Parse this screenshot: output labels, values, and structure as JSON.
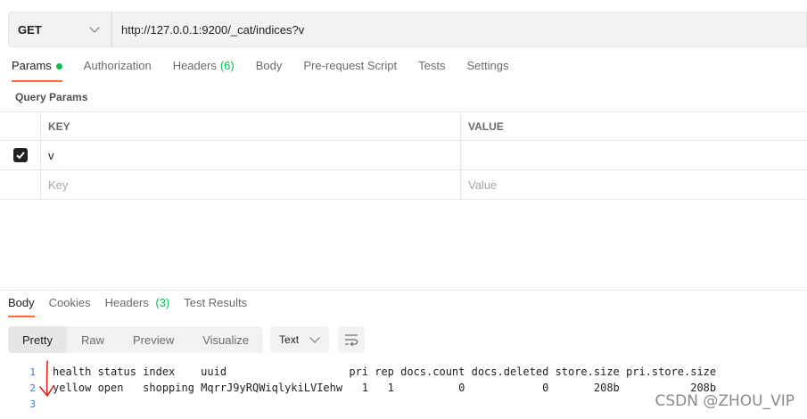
{
  "request": {
    "method": "GET",
    "url": "http://127.0.0.1:9200/_cat/indices?v"
  },
  "request_tabs": [
    {
      "label": "Params",
      "active": true
    },
    {
      "label": "Authorization"
    },
    {
      "label": "Headers",
      "count": "(6)"
    },
    {
      "label": "Body"
    },
    {
      "label": "Pre-request Script"
    },
    {
      "label": "Tests"
    },
    {
      "label": "Settings"
    }
  ],
  "query_params": {
    "title": "Query Params",
    "header": {
      "key": "KEY",
      "value": "VALUE"
    },
    "rows": [
      {
        "key": "v",
        "value": "",
        "checked": true
      }
    ],
    "placeholder": {
      "key": "Key",
      "value": "Value"
    }
  },
  "response_tabs": [
    {
      "label": "Body",
      "active": true
    },
    {
      "label": "Cookies"
    },
    {
      "label": "Headers",
      "count": "(3)"
    },
    {
      "label": "Test Results"
    }
  ],
  "view_modes": [
    "Pretty",
    "Raw",
    "Preview",
    "Visualize"
  ],
  "active_view": "Pretty",
  "format": "Text",
  "response_lines": [
    {
      "n": "1",
      "text": "health status index    uuid                   pri rep docs.count docs.deleted store.size pri.store.size"
    },
    {
      "n": "2",
      "text": "yellow open   shopping MqrrJ9yRQWiqlykiLVIehw   1   1          0            0       208b           208b"
    },
    {
      "n": "3",
      "text": ""
    }
  ],
  "watermark": "CSDN @ZHOU_VIP",
  "colors": {
    "accent": "#ff6c37",
    "green": "#0cbb52",
    "annotation": "#d9261c"
  },
  "icons": {
    "method_dropdown": "chevron-down-icon",
    "checkbox": "check-icon",
    "wrap": "wrap-lines-icon"
  }
}
